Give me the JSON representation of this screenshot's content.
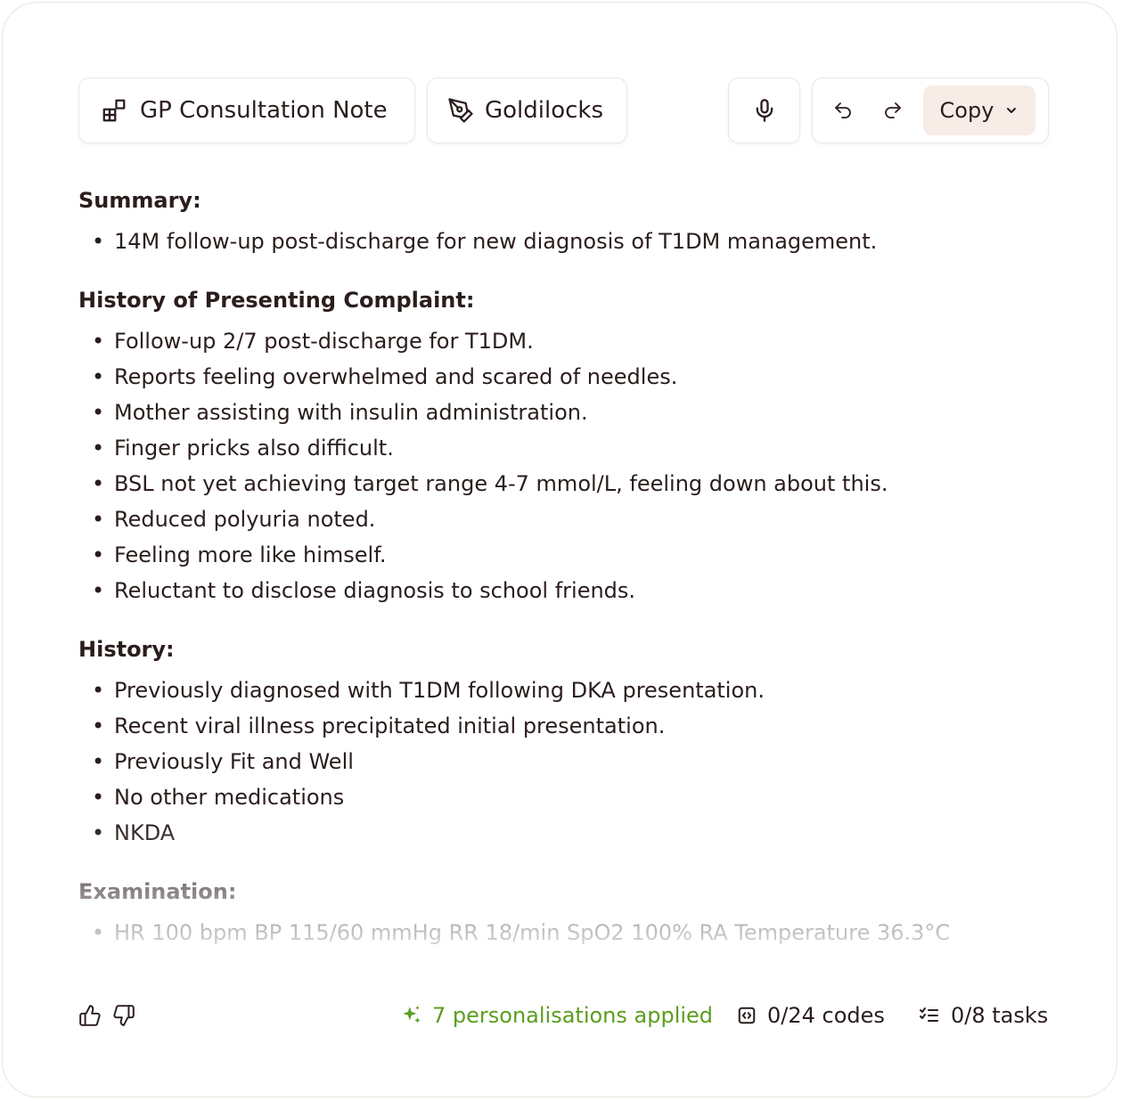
{
  "toolbar": {
    "template_label": "GP Consultation Note",
    "style_label": "Goldilocks",
    "copy_label": "Copy"
  },
  "note": {
    "sections": [
      {
        "title": "Summary:",
        "items": [
          "14M follow-up post-discharge for new diagnosis of T1DM management."
        ]
      },
      {
        "title": "History of Presenting Complaint:",
        "items": [
          "Follow-up 2/7 post-discharge for T1DM.",
          "Reports feeling overwhelmed and scared of needles.",
          "Mother assisting with insulin administration.",
          "Finger pricks also difficult.",
          "BSL not yet achieving target range 4-7 mmol/L, feeling down about this.",
          "Reduced polyuria noted.",
          "Feeling more like himself.",
          "Reluctant to disclose diagnosis to school friends."
        ]
      },
      {
        "title": "History:",
        "items": [
          "Previously diagnosed with T1DM following DKA presentation.",
          "Recent viral illness precipitated initial presentation.",
          "Previously Fit and Well",
          "No other medications",
          "NKDA"
        ]
      },
      {
        "title": "Examination:",
        "items": [
          "HR 100 bpm BP 115/60 mmHg RR 18/min SpO2 100% RA Temperature 36.3°C"
        ]
      }
    ]
  },
  "footer": {
    "personalisations_label": "7 personalisations applied",
    "codes_label": "0/24 codes",
    "tasks_label": "0/8 tasks"
  },
  "colors": {
    "accent_green": "#5b9e1f",
    "copy_button_bg": "#f7ece6",
    "text": "#2a1d1c",
    "border": "#ede6e1"
  },
  "icons": [
    "template-icon",
    "pen-tool-icon",
    "microphone-icon",
    "undo-icon",
    "redo-icon",
    "chevron-down-icon",
    "thumbs-up-icon",
    "thumbs-down-icon",
    "sparkles-icon",
    "code-icon",
    "tasks-icon"
  ]
}
